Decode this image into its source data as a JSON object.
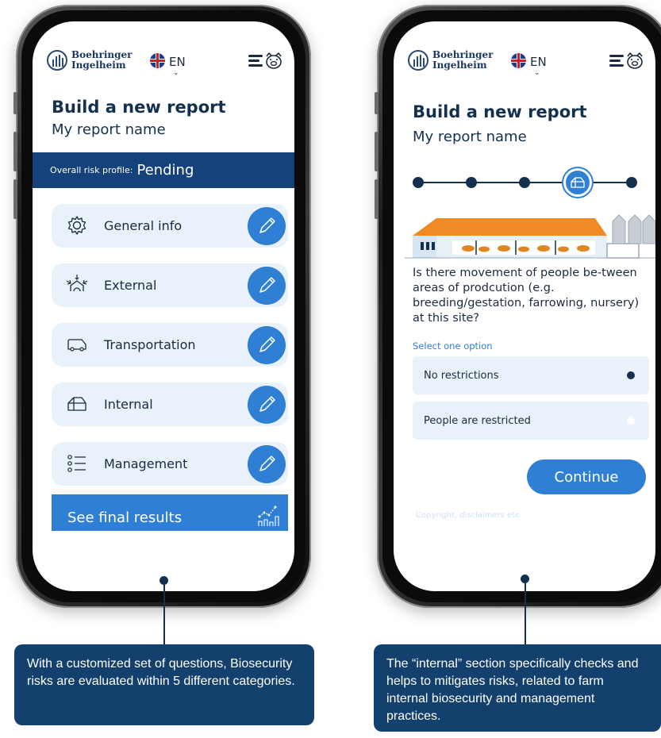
{
  "brand": {
    "name_line1": "Boehringer",
    "name_line2": "Ingelheim",
    "language": "EN",
    "language_chevron": "⌄"
  },
  "colors": {
    "navy": "#14304f",
    "primary_blue": "#2f7fd4",
    "risk_bar": "#15427a",
    "card_bg": "#e9f2fb",
    "callout_bg": "#14406d",
    "barn_roof": "#f08a24"
  },
  "left_screen": {
    "title": "Build a new report",
    "report_name": "My report name",
    "risk_profile": {
      "label": "Overall risk profile:",
      "value": "Pending"
    },
    "categories": [
      {
        "label": "General info",
        "icon": "gear-icon",
        "action_icon": "pencil-icon"
      },
      {
        "label": "External",
        "icon": "external-threat-icon",
        "action_icon": "pencil-icon"
      },
      {
        "label": "Transportation",
        "icon": "truck-icon",
        "action_icon": "pencil-icon"
      },
      {
        "label": "Internal",
        "icon": "barn-icon",
        "action_icon": "pencil-icon"
      },
      {
        "label": "Management",
        "icon": "checklist-icon",
        "action_icon": "pencil-icon"
      }
    ],
    "final_button": {
      "label": "See final results",
      "icon": "chart-icon"
    }
  },
  "right_screen": {
    "title": "Build a new report",
    "report_name": "My report name",
    "stepper": {
      "total_steps": 5,
      "current_step": 4,
      "current_icon": "barn-icon"
    },
    "question": "Is there movement of people be-tween areas of prodcution (e.g. breeding/gestation, farrowing, nursery) at this site?",
    "hint": "Select one option",
    "options": [
      {
        "label": "No restrictions",
        "selected": true
      },
      {
        "label": "People are restricted",
        "selected": false
      }
    ],
    "continue_label": "Continue",
    "copyright": "Copyright, disclaimers etc"
  },
  "callouts": {
    "left": "With a customized set of questions, Biosecurity risks are evaluated within 5 different categories.",
    "right": "The “internal” section specifically checks and helps to mitigates risks, related to farm internal biosecurity and management practices."
  }
}
